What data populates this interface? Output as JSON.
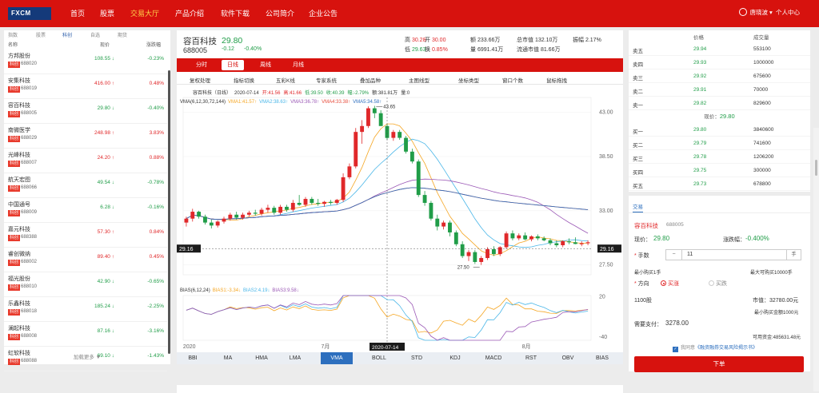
{
  "nav": {
    "logo_text": "FXCM",
    "items": [
      "首页",
      "股票",
      "交易大厅",
      "产品介绍",
      "软件下载",
      "公司简介",
      "企业公告"
    ],
    "active_index": 2,
    "username": "唐晓波",
    "user_menu": "个人中心"
  },
  "left": {
    "tabs": [
      "指数",
      "股票",
      "科创",
      "自选",
      "期货"
    ],
    "active_tab": 2,
    "header": {
      "name": "名称",
      "price": "现价",
      "change": "涨跌幅"
    },
    "tag": "科创",
    "stocks": [
      {
        "name": "方邦股份",
        "code": "688020",
        "price": "108.55",
        "arrow": "↓",
        "change": "-0.23%",
        "dir": "dn"
      },
      {
        "name": "安集科技",
        "code": "688019",
        "price": "416.00",
        "arrow": "↑",
        "change": "0.48%",
        "dir": "up"
      },
      {
        "name": "容百科技",
        "code": "688005",
        "price": "29.80",
        "arrow": "↓",
        "change": "-0.40%",
        "dir": "dn"
      },
      {
        "name": "南微医学",
        "code": "688029",
        "price": "248.98",
        "arrow": "↑",
        "change": "3.83%",
        "dir": "up"
      },
      {
        "name": "光峰科技",
        "code": "688007",
        "price": "24.20",
        "arrow": "↑",
        "change": "0.88%",
        "dir": "up"
      },
      {
        "name": "航天宏图",
        "code": "688066",
        "price": "49.54",
        "arrow": "↓",
        "change": "-0.78%",
        "dir": "dn"
      },
      {
        "name": "中国通号",
        "code": "688009",
        "price": "6.28",
        "arrow": "↓",
        "change": "-0.16%",
        "dir": "dn"
      },
      {
        "name": "嘉元科技",
        "code": "688388",
        "price": "57.30",
        "arrow": "↑",
        "change": "0.84%",
        "dir": "up"
      },
      {
        "name": "睿创微纳",
        "code": "688002",
        "price": "89.40",
        "arrow": "↑",
        "change": "0.45%",
        "dir": "up"
      },
      {
        "name": "福光股份",
        "code": "688010",
        "price": "42.90",
        "arrow": "↓",
        "change": "-0.65%",
        "dir": "dn"
      },
      {
        "name": "乐鑫科技",
        "code": "688018",
        "price": "185.24",
        "arrow": "↓",
        "change": "-2.25%",
        "dir": "dn"
      },
      {
        "name": "澜起科技",
        "code": "688008",
        "price": "87.16",
        "arrow": "↓",
        "change": "-3.16%",
        "dir": "dn"
      },
      {
        "name": "虹软科技",
        "code": "688088",
        "price": "69.10",
        "arrow": "↓",
        "change": "-1.43%",
        "dir": "dn"
      }
    ],
    "load_more": "加载更多 ▼"
  },
  "quote": {
    "name": "容百科技",
    "code": "688005",
    "price": "29.80",
    "change": "-0.12",
    "pct": "-0.40%",
    "stats": [
      {
        "label": "高",
        "value": "30.28",
        "cls": "up"
      },
      {
        "label": "开",
        "value": "30.00",
        "cls": "up"
      },
      {
        "label": "额",
        "value": "233.66万",
        "cls": ""
      },
      {
        "label": "总市值",
        "value": "132.10万",
        "cls": ""
      },
      {
        "label": "振幅",
        "value": "2.17%",
        "cls": ""
      },
      {
        "label": "低",
        "value": "29.63",
        "cls": "dn"
      },
      {
        "label": "换",
        "value": "0.85%",
        "cls": "up"
      },
      {
        "label": "量",
        "value": "6991.41万",
        "cls": ""
      },
      {
        "label": "流通市值",
        "value": "81.66万",
        "cls": ""
      }
    ]
  },
  "periods": [
    "分时",
    "日线",
    "周线",
    "月线"
  ],
  "active_period": 1,
  "toolbar": [
    "复权处理",
    "指标切换",
    "五彩K线",
    "专家系统",
    "叠加品种",
    "主图线型",
    "坐标类型",
    "窗口个数",
    "鼠标拖拽"
  ],
  "chart_data": {
    "type": "candlestick",
    "legend_top": {
      "title": "容百科技（日线）",
      "date": "2020-07-14",
      "open": "开:41.56",
      "high": "高:41.66",
      "low": "低:39.50",
      "close": "收:40.39",
      "change": "幅:-2.79%",
      "amount": "额:381.81万",
      "volume": "量:0"
    },
    "ma_legend": [
      {
        "text": "VMA(6,12,30,72,144)",
        "color": "#333333"
      },
      {
        "text": "VMA1:41.57↑",
        "color": "#f5a623"
      },
      {
        "text": "VMA2:38.63↑",
        "color": "#49b6e8"
      },
      {
        "text": "VMA3:36.78↑",
        "color": "#9b59b6"
      },
      {
        "text": "VMA4:33.38↑",
        "color": "#e74c3c"
      },
      {
        "text": "VMA5:34.58↑",
        "color": "#2d6fbe"
      }
    ],
    "price_ticks": [
      "43.00",
      "38.50",
      "33.00",
      "27.50"
    ],
    "ylim": [
      26.5,
      44.5
    ],
    "high_marker": "43.65",
    "low_marker": "27.50",
    "cursor_price": "29.16",
    "candles": [
      [
        31.8,
        32.4,
        31.4,
        32.2
      ],
      [
        32.2,
        33.2,
        31.9,
        32.9
      ],
      [
        32.9,
        33.0,
        32.2,
        32.4
      ],
      [
        32.4,
        32.6,
        31.6,
        31.8
      ],
      [
        31.8,
        32.1,
        31.2,
        31.5
      ],
      [
        31.5,
        32.0,
        31.3,
        31.9
      ],
      [
        31.9,
        32.4,
        31.7,
        32.2
      ],
      [
        32.2,
        32.8,
        32.0,
        32.6
      ],
      [
        32.6,
        32.9,
        32.1,
        32.3
      ],
      [
        32.3,
        32.8,
        32.1,
        32.6
      ],
      [
        32.6,
        33.0,
        32.4,
        32.8
      ],
      [
        32.8,
        33.1,
        32.5,
        32.7
      ],
      [
        32.7,
        33.3,
        32.5,
        33.1
      ],
      [
        33.1,
        33.6,
        32.8,
        33.3
      ],
      [
        33.3,
        33.5,
        32.6,
        32.8
      ],
      [
        32.8,
        33.6,
        32.6,
        33.4
      ],
      [
        33.4,
        33.6,
        32.9,
        33.1
      ],
      [
        33.1,
        34.1,
        32.9,
        33.8
      ],
      [
        33.8,
        34.6,
        33.5,
        33.6
      ],
      [
        33.6,
        34.4,
        33.4,
        34.2
      ],
      [
        34.2,
        34.4,
        33.6,
        33.8
      ],
      [
        33.8,
        34.2,
        33.5,
        33.7
      ],
      [
        33.7,
        34.0,
        33.4,
        33.9
      ],
      [
        33.9,
        34.1,
        33.6,
        33.8
      ],
      [
        33.8,
        34.2,
        33.6,
        34.1
      ],
      [
        34.1,
        36.8,
        33.9,
        36.4
      ],
      [
        36.4,
        37.8,
        36.2,
        37.5
      ],
      [
        37.5,
        41.4,
        37.3,
        41.0
      ],
      [
        41.0,
        42.2,
        39.8,
        41.6
      ],
      [
        41.6,
        43.6,
        41.4,
        43.4
      ],
      [
        43.4,
        43.65,
        42.4,
        42.9
      ],
      [
        42.9,
        43.2,
        41.6,
        41.6
      ],
      [
        41.6,
        41.8,
        40.2,
        40.39
      ],
      [
        40.4,
        41.2,
        40.1,
        41.0
      ],
      [
        41.0,
        41.2,
        40.2,
        40.4
      ],
      [
        40.4,
        40.6,
        38.8,
        39.0
      ],
      [
        39.0,
        39.3,
        37.8,
        38.0
      ],
      [
        38.0,
        38.2,
        34.4,
        34.6
      ],
      [
        34.6,
        35.0,
        33.5,
        33.8
      ],
      [
        33.8,
        34.0,
        32.0,
        32.2
      ],
      [
        32.2,
        32.6,
        31.0,
        31.4
      ],
      [
        31.4,
        32.0,
        31.1,
        31.8
      ],
      [
        31.8,
        32.0,
        30.4,
        30.8
      ],
      [
        30.8,
        31.0,
        29.4,
        29.6
      ],
      [
        29.6,
        29.9,
        28.2,
        28.4
      ],
      [
        28.4,
        29.0,
        27.9,
        28.8
      ],
      [
        28.8,
        29.0,
        27.6,
        27.8
      ],
      [
        27.8,
        28.4,
        27.5,
        28.2
      ],
      [
        28.2,
        29.3,
        28.0,
        29.1
      ],
      [
        29.1,
        29.4,
        28.4,
        28.6
      ],
      [
        28.6,
        29.4,
        28.4,
        29.3
      ],
      [
        29.3,
        30.9,
        29.1,
        30.7
      ],
      [
        30.7,
        31.0,
        30.0,
        30.2
      ],
      [
        30.2,
        30.7,
        30.0,
        30.5
      ],
      [
        30.5,
        30.8,
        30.0,
        30.1
      ],
      [
        30.1,
        30.5,
        29.9,
        30.4
      ],
      [
        30.4,
        30.6,
        30.0,
        30.2
      ],
      [
        30.2,
        30.4,
        29.9,
        30.0
      ],
      [
        30.0,
        30.2,
        29.5,
        29.7
      ],
      [
        29.7,
        30.0,
        29.3,
        29.5
      ],
      [
        29.5,
        30.0,
        29.3,
        29.9
      ],
      [
        29.9,
        30.2,
        29.6,
        29.8
      ],
      [
        29.8,
        30.3,
        29.6,
        29.63
      ],
      [
        29.6,
        29.9,
        29.4,
        29.7
      ],
      [
        29.7,
        30.0,
        29.5,
        29.8
      ]
    ],
    "bias": {
      "title": "BIAS(6,12,24)",
      "legend": [
        {
          "text": "BIAS1:-3.34↓",
          "color": "#f5a623"
        },
        {
          "text": "BIAS2:4.19↓",
          "color": "#49b6e8"
        },
        {
          "text": "BIAS3:9.58↓",
          "color": "#9b59b6"
        }
      ],
      "ticks": [
        "20",
        "-40"
      ],
      "ylim": [
        -45,
        22
      ]
    },
    "x_labels": [
      {
        "text": "2020",
        "index": 0
      },
      {
        "text": "7月",
        "index": 22
      },
      {
        "text": "8月",
        "index": 54
      }
    ],
    "cursor_date": "2020-07-14",
    "cursor_index": 32
  },
  "indicators": [
    "BBI",
    "MA",
    "HMA",
    "LMA",
    "VMA",
    "BOLL",
    "STD",
    "KDJ",
    "MACD",
    "RST",
    "OBV",
    "BIAS"
  ],
  "active_indicator": 4,
  "orderbook": {
    "header": {
      "price": "价格",
      "volume": "成交量"
    },
    "asks": [
      {
        "label": "卖五",
        "price": "29.94",
        "volume": "553100"
      },
      {
        "label": "卖四",
        "price": "29.93",
        "volume": "1000000"
      },
      {
        "label": "卖三",
        "price": "29.92",
        "volume": "675600"
      },
      {
        "label": "卖二",
        "price": "29.91",
        "volume": "70000"
      },
      {
        "label": "卖一",
        "price": "29.82",
        "volume": "829600"
      }
    ],
    "current_label": "现价：",
    "current_price": "29.80",
    "bids": [
      {
        "label": "买一",
        "price": "29.80",
        "volume": "3840600"
      },
      {
        "label": "买二",
        "price": "29.79",
        "volume": "741600"
      },
      {
        "label": "买三",
        "price": "29.78",
        "volume": "1206200"
      },
      {
        "label": "买四",
        "price": "29.75",
        "volume": "300000"
      },
      {
        "label": "买五",
        "price": "29.73",
        "volume": "678800"
      }
    ]
  },
  "trade": {
    "tab": "交易",
    "stock_name": "容百科技",
    "stock_code": "688005",
    "price_label": "现价：",
    "price": "29.80",
    "change_label": "涨跌幅：",
    "change": "-0.400%",
    "qty_label": "手数",
    "qty_minus": "−",
    "qty_value": "11",
    "qty_unit": "手",
    "min_buy": "最小购买1手",
    "max_buy": "最大可购买10000手",
    "dir_label": "方向",
    "dir_buy": "买涨",
    "dir_sell": "买跌",
    "shares": "1100股",
    "market_label": "市值：",
    "market_value": "32780.00元",
    "min_amount": "最小购买金额1000元",
    "pay_label": "需要支付：",
    "pay_value": "3278.00",
    "available": "可用资金:485631.48元",
    "agree_prefix": "我同意",
    "agree_link": "《融资融券交易风险揭示书》",
    "submit": "下单"
  }
}
